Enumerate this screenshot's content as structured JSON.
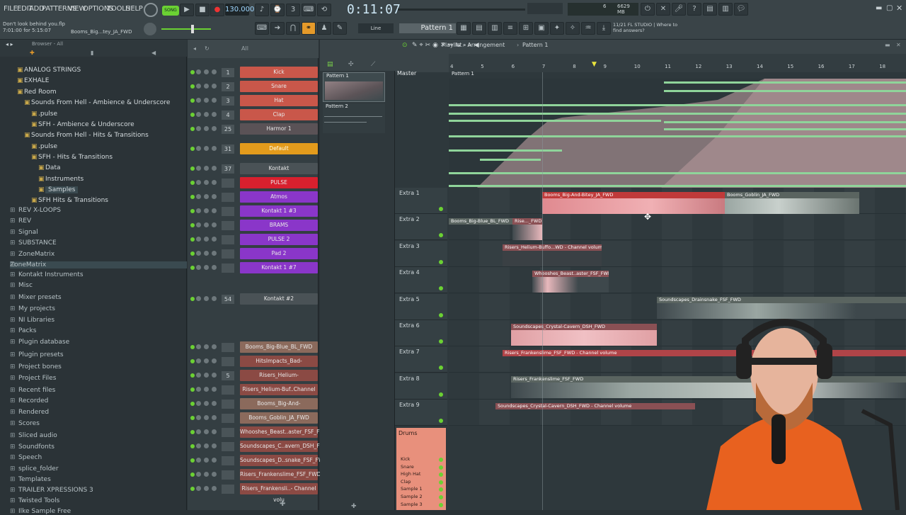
{
  "topbar": {
    "menu": [
      "FILE",
      "EDIT",
      "ADD",
      "PATTERNS",
      "VIEW",
      "OPTIONS",
      "TOOLS",
      "HELP"
    ],
    "song_button": "SONG",
    "tempo": "130.000",
    "time": "0:11:07",
    "project_name": "Don't look behind you.flp",
    "project_time": "7:01:00 for 5:15:07",
    "hint": "Booms_Big...tey_JA_FWD",
    "memory": "6629 MB",
    "cpu": "6",
    "snap_mode": "Line",
    "pattern_selector": "Pattern 1",
    "news": "11/21 FL STUDIO | Where to find answers?"
  },
  "browser": {
    "header": "Browser - All",
    "items": [
      "ANALOG STRINGS",
      "EXHALE",
      "Red Room",
      "Sounds From Hell - Ambience & Underscore",
      ".pulse",
      "SFH - Ambience & Underscore",
      "Sounds From Hell - Hits & Transitions",
      ".pulse",
      "SFH - Hits & Transitions",
      "Data",
      "Instruments",
      "Samples",
      "SFH Hits & Transitions",
      "REV X-LOOPS",
      "REV",
      "Signal",
      "SUBSTANCE",
      "ZoneMatrix",
      "ZoneMatrix",
      "Kontakt Instruments",
      "Misc",
      "Mixer presets",
      "My projects",
      "NI Libraries",
      "Packs",
      "Plugin database",
      "Plugin presets",
      "Project bones",
      "Project Files",
      "Recent files",
      "Recorded",
      "Rendered",
      "Scores",
      "Sliced audio",
      "Soundfonts",
      "Speech",
      "splice_folder",
      "Templates",
      "TRAILER XPRESSIONS 3",
      "Twisted Tools",
      "Ilke Sample Free"
    ]
  },
  "rack": {
    "filter": "All",
    "channels": [
      {
        "num": "1",
        "name": "Kick",
        "color": "#c9574a"
      },
      {
        "num": "2",
        "name": "Snare",
        "color": "#c9574a"
      },
      {
        "num": "3",
        "name": "Hat",
        "color": "#c9574a"
      },
      {
        "num": "4",
        "name": "Clap",
        "color": "#c9574a"
      },
      {
        "num": "25",
        "name": "Harmor 1",
        "color": "#5a5256"
      },
      {
        "num": "31",
        "name": "Default",
        "color": "#e39b1c"
      },
      {
        "num": "37",
        "name": "Kontakt",
        "color": "#4a5256"
      },
      {
        "num": "",
        "name": "PULSE",
        "color": "#d8202e"
      },
      {
        "num": "",
        "name": "Atmos",
        "color": "#8a36c9"
      },
      {
        "num": "",
        "name": "Kontakt 1 #3",
        "color": "#8a36c9"
      },
      {
        "num": "",
        "name": "BRAMS",
        "color": "#8a36c9"
      },
      {
        "num": "",
        "name": "PULSE 2",
        "color": "#8a36c9"
      },
      {
        "num": "",
        "name": "Pad 2",
        "color": "#8a36c9"
      },
      {
        "num": "",
        "name": "Kontakt 1 #7",
        "color": "#8a36c9"
      },
      {
        "num": "54",
        "name": "Kontakt #2",
        "color": "#4a5256"
      },
      {
        "num": "",
        "name": "Booms_Big-Blue_BL_FWD",
        "color": "#8b6a5c"
      },
      {
        "num": "",
        "name": "HitsImpacts_Bad-Omen_MK_REV",
        "color": "#8b4a44"
      },
      {
        "num": "5",
        "name": "Risers_Helium-Buffoon_FSF_FWD",
        "color": "#8b4a44"
      },
      {
        "num": "",
        "name": "Risers_Helium-Buf..Channel volu",
        "color": "#8b4a44"
      },
      {
        "num": "",
        "name": "Booms_Big-And-Bitey_JA_FWD",
        "color": "#8b6a5c"
      },
      {
        "num": "",
        "name": "Booms_Goblin_JA_FWD",
        "color": "#8b6a5c"
      },
      {
        "num": "",
        "name": "Whooshes_Beast..aster_FSF_FWD",
        "color": "#8b4a44"
      },
      {
        "num": "",
        "name": "Soundscapes_C..avern_DSH_FWD",
        "color": "#8b4a44"
      },
      {
        "num": "",
        "name": "Soundscapes_D..snake_FSF_FWD",
        "color": "#8b4a44"
      },
      {
        "num": "",
        "name": "Risers_Frankenslime_FSF_FWD",
        "color": "#8b4a44"
      },
      {
        "num": "",
        "name": "Risers_Frankensli..- Channel volu",
        "color": "#8b4a44"
      }
    ]
  },
  "picker": {
    "patterns": [
      "Pattern 1",
      "Pattern 2"
    ]
  },
  "playlist": {
    "title": "Playlist - Arrangement",
    "pattern": "Pattern 1",
    "master_label": "Master",
    "pattern_lane": "Pattern 1",
    "ruler": [
      "4",
      "5",
      "6",
      "7",
      "8",
      "9",
      "10",
      "11",
      "12",
      "13",
      "14",
      "15",
      "16",
      "17",
      "18"
    ],
    "tracks": [
      "Extra 1",
      "Extra 2",
      "Extra 3",
      "Extra 4",
      "Extra 5",
      "Extra 6",
      "Extra 7",
      "Extra 8",
      "Extra 9"
    ],
    "drums_label": "Drums",
    "drum_rows": [
      "Kick",
      "Snare",
      "High Hat",
      "Clap",
      "Sample 1",
      "Sample 2",
      "Sample 3"
    ],
    "clips": [
      {
        "name": "Booms_Big-And-Bitey_JA_FWD"
      },
      {
        "name": "Booms_Goblin_JA_FWD"
      },
      {
        "name": "Booms_Big-Blue_BL_FWD"
      },
      {
        "name": "Rise..._FWD"
      },
      {
        "name": "Risers_Helium-Buffo...WD - Channel volume"
      },
      {
        "name": "Whooshes_Beast..aster_FSF_FWD"
      },
      {
        "name": "Soundscapes_Drainsnake_FSF_FWD"
      },
      {
        "name": "Soundscapes_Crystal-Cavern_DSH_FWD"
      },
      {
        "name": "Risers_Frankenslime_FSF_FWD - Channel volume"
      },
      {
        "name": "Risers_Frankenslime_FSF_FWD"
      },
      {
        "name": "Soundscapes_Crystal-Cavern_DSH_FWD - Channel volume"
      }
    ]
  },
  "colors": {
    "accent_green": "#6bd133",
    "clip_red": "#c94a4a",
    "clip_pink": "#e8a0a4",
    "clip_teal": "#6a8a80",
    "automation": "#8fd49a"
  }
}
